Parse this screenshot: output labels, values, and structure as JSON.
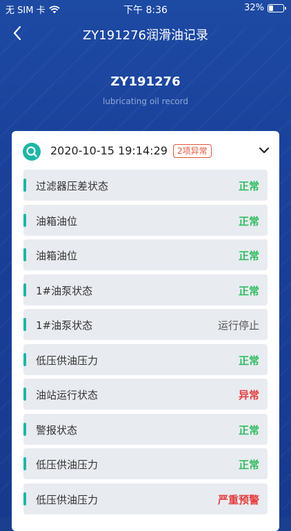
{
  "status_bar": {
    "carrier": "无 SIM 卡",
    "time": "下午 8:36",
    "battery": "32%",
    "battery_level": 0.32
  },
  "nav": {
    "title": "ZY191276润滑油记录"
  },
  "hero": {
    "device_id": "ZY191276",
    "subtitle": "lubricating oil record"
  },
  "record": {
    "datetime": "2020-10-15 19:14:29",
    "badge": "2项异常",
    "items": [
      {
        "label": "过滤器压差状态",
        "status": "正常",
        "type": "normal"
      },
      {
        "label": "油箱油位",
        "status": "正常",
        "type": "normal"
      },
      {
        "label": "油箱油位",
        "status": "正常",
        "type": "normal"
      },
      {
        "label": "1#油泵状态",
        "status": "正常",
        "type": "normal"
      },
      {
        "label": "1#油泵状态",
        "status": "运行停止",
        "type": "stopped"
      },
      {
        "label": "低压供油压力",
        "status": "正常",
        "type": "normal"
      },
      {
        "label": "油站运行状态",
        "status": "异常",
        "type": "abnormal"
      },
      {
        "label": "警报状态",
        "status": "正常",
        "type": "normal"
      },
      {
        "label": "低压供油压力",
        "status": "正常",
        "type": "normal"
      },
      {
        "label": "低压供油压力",
        "status": "严重预警",
        "type": "warn"
      }
    ]
  },
  "colors": {
    "background": "#1a409a",
    "accent": "#1fb5a8",
    "normal": "#2ebd5f",
    "abnormal": "#e43d3d"
  },
  "icons": {
    "back": "chevron-left-icon",
    "record": "search-icon",
    "expand": "chevron-down-icon",
    "wifi": "wifi-icon",
    "battery": "battery-icon"
  }
}
